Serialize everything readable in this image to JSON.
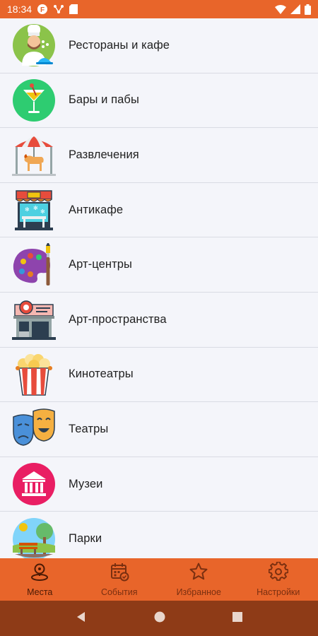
{
  "status": {
    "time": "18:34"
  },
  "categories": [
    {
      "label": "Рестораны и кафе",
      "icon": "chef-icon"
    },
    {
      "label": "Бары и пабы",
      "icon": "cocktail-icon"
    },
    {
      "label": "Развлечения",
      "icon": "carousel-icon"
    },
    {
      "label": "Антикафе",
      "icon": "anticafe-icon"
    },
    {
      "label": "Арт-центры",
      "icon": "palette-icon"
    },
    {
      "label": "Арт-пространства",
      "icon": "art-space-icon"
    },
    {
      "label": "Кинотеатры",
      "icon": "popcorn-icon"
    },
    {
      "label": "Театры",
      "icon": "theater-masks-icon"
    },
    {
      "label": "Музеи",
      "icon": "museum-icon"
    },
    {
      "label": "Парки",
      "icon": "park-icon"
    }
  ],
  "tabs": [
    {
      "label": "Места",
      "icon": "place-pin-icon",
      "active": true
    },
    {
      "label": "События",
      "icon": "calendar-icon",
      "active": false
    },
    {
      "label": "Избранное",
      "icon": "star-icon",
      "active": false
    },
    {
      "label": "Настройки",
      "icon": "gear-icon",
      "active": false
    }
  ],
  "colors": {
    "accent": "#e8652a",
    "nav_bar": "#8e3b17",
    "background": "#f4f5fa"
  }
}
